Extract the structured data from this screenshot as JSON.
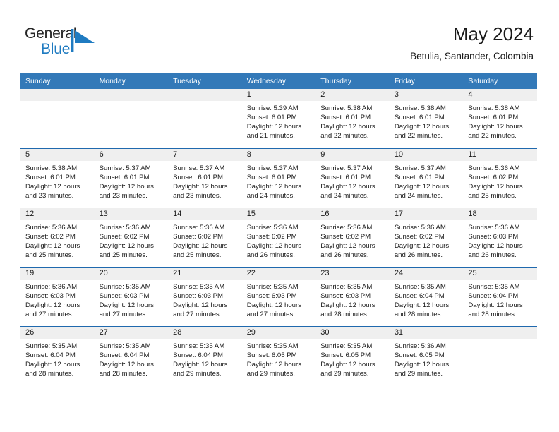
{
  "brand": {
    "name_part1": "General",
    "name_part2": "Blue",
    "mark_icon": "blue-flag-triangle-icon",
    "accent_color": "#1f7bc1"
  },
  "header": {
    "title": "May 2024",
    "subtitle": "Betulia, Santander, Colombia"
  },
  "colors": {
    "header_row_bg": "#3379b8",
    "row_separator": "#1f69ae",
    "daynum_bg": "#efefef",
    "text": "#1a1a1a"
  },
  "weekdays": [
    "Sunday",
    "Monday",
    "Tuesday",
    "Wednesday",
    "Thursday",
    "Friday",
    "Saturday"
  ],
  "weeks": [
    [
      {
        "day": "",
        "empty": true,
        "sunrise": "",
        "sunset": "",
        "daylight1": "",
        "daylight2": ""
      },
      {
        "day": "",
        "empty": true,
        "sunrise": "",
        "sunset": "",
        "daylight1": "",
        "daylight2": ""
      },
      {
        "day": "",
        "empty": true,
        "sunrise": "",
        "sunset": "",
        "daylight1": "",
        "daylight2": ""
      },
      {
        "day": "1",
        "empty": false,
        "sunrise": "Sunrise: 5:39 AM",
        "sunset": "Sunset: 6:01 PM",
        "daylight1": "Daylight: 12 hours",
        "daylight2": "and 21 minutes."
      },
      {
        "day": "2",
        "empty": false,
        "sunrise": "Sunrise: 5:38 AM",
        "sunset": "Sunset: 6:01 PM",
        "daylight1": "Daylight: 12 hours",
        "daylight2": "and 22 minutes."
      },
      {
        "day": "3",
        "empty": false,
        "sunrise": "Sunrise: 5:38 AM",
        "sunset": "Sunset: 6:01 PM",
        "daylight1": "Daylight: 12 hours",
        "daylight2": "and 22 minutes."
      },
      {
        "day": "4",
        "empty": false,
        "sunrise": "Sunrise: 5:38 AM",
        "sunset": "Sunset: 6:01 PM",
        "daylight1": "Daylight: 12 hours",
        "daylight2": "and 22 minutes."
      }
    ],
    [
      {
        "day": "5",
        "empty": false,
        "sunrise": "Sunrise: 5:38 AM",
        "sunset": "Sunset: 6:01 PM",
        "daylight1": "Daylight: 12 hours",
        "daylight2": "and 23 minutes."
      },
      {
        "day": "6",
        "empty": false,
        "sunrise": "Sunrise: 5:37 AM",
        "sunset": "Sunset: 6:01 PM",
        "daylight1": "Daylight: 12 hours",
        "daylight2": "and 23 minutes."
      },
      {
        "day": "7",
        "empty": false,
        "sunrise": "Sunrise: 5:37 AM",
        "sunset": "Sunset: 6:01 PM",
        "daylight1": "Daylight: 12 hours",
        "daylight2": "and 23 minutes."
      },
      {
        "day": "8",
        "empty": false,
        "sunrise": "Sunrise: 5:37 AM",
        "sunset": "Sunset: 6:01 PM",
        "daylight1": "Daylight: 12 hours",
        "daylight2": "and 24 minutes."
      },
      {
        "day": "9",
        "empty": false,
        "sunrise": "Sunrise: 5:37 AM",
        "sunset": "Sunset: 6:01 PM",
        "daylight1": "Daylight: 12 hours",
        "daylight2": "and 24 minutes."
      },
      {
        "day": "10",
        "empty": false,
        "sunrise": "Sunrise: 5:37 AM",
        "sunset": "Sunset: 6:01 PM",
        "daylight1": "Daylight: 12 hours",
        "daylight2": "and 24 minutes."
      },
      {
        "day": "11",
        "empty": false,
        "sunrise": "Sunrise: 5:36 AM",
        "sunset": "Sunset: 6:02 PM",
        "daylight1": "Daylight: 12 hours",
        "daylight2": "and 25 minutes."
      }
    ],
    [
      {
        "day": "12",
        "empty": false,
        "sunrise": "Sunrise: 5:36 AM",
        "sunset": "Sunset: 6:02 PM",
        "daylight1": "Daylight: 12 hours",
        "daylight2": "and 25 minutes."
      },
      {
        "day": "13",
        "empty": false,
        "sunrise": "Sunrise: 5:36 AM",
        "sunset": "Sunset: 6:02 PM",
        "daylight1": "Daylight: 12 hours",
        "daylight2": "and 25 minutes."
      },
      {
        "day": "14",
        "empty": false,
        "sunrise": "Sunrise: 5:36 AM",
        "sunset": "Sunset: 6:02 PM",
        "daylight1": "Daylight: 12 hours",
        "daylight2": "and 25 minutes."
      },
      {
        "day": "15",
        "empty": false,
        "sunrise": "Sunrise: 5:36 AM",
        "sunset": "Sunset: 6:02 PM",
        "daylight1": "Daylight: 12 hours",
        "daylight2": "and 26 minutes."
      },
      {
        "day": "16",
        "empty": false,
        "sunrise": "Sunrise: 5:36 AM",
        "sunset": "Sunset: 6:02 PM",
        "daylight1": "Daylight: 12 hours",
        "daylight2": "and 26 minutes."
      },
      {
        "day": "17",
        "empty": false,
        "sunrise": "Sunrise: 5:36 AM",
        "sunset": "Sunset: 6:02 PM",
        "daylight1": "Daylight: 12 hours",
        "daylight2": "and 26 minutes."
      },
      {
        "day": "18",
        "empty": false,
        "sunrise": "Sunrise: 5:36 AM",
        "sunset": "Sunset: 6:03 PM",
        "daylight1": "Daylight: 12 hours",
        "daylight2": "and 26 minutes."
      }
    ],
    [
      {
        "day": "19",
        "empty": false,
        "sunrise": "Sunrise: 5:36 AM",
        "sunset": "Sunset: 6:03 PM",
        "daylight1": "Daylight: 12 hours",
        "daylight2": "and 27 minutes."
      },
      {
        "day": "20",
        "empty": false,
        "sunrise": "Sunrise: 5:35 AM",
        "sunset": "Sunset: 6:03 PM",
        "daylight1": "Daylight: 12 hours",
        "daylight2": "and 27 minutes."
      },
      {
        "day": "21",
        "empty": false,
        "sunrise": "Sunrise: 5:35 AM",
        "sunset": "Sunset: 6:03 PM",
        "daylight1": "Daylight: 12 hours",
        "daylight2": "and 27 minutes."
      },
      {
        "day": "22",
        "empty": false,
        "sunrise": "Sunrise: 5:35 AM",
        "sunset": "Sunset: 6:03 PM",
        "daylight1": "Daylight: 12 hours",
        "daylight2": "and 27 minutes."
      },
      {
        "day": "23",
        "empty": false,
        "sunrise": "Sunrise: 5:35 AM",
        "sunset": "Sunset: 6:03 PM",
        "daylight1": "Daylight: 12 hours",
        "daylight2": "and 28 minutes."
      },
      {
        "day": "24",
        "empty": false,
        "sunrise": "Sunrise: 5:35 AM",
        "sunset": "Sunset: 6:04 PM",
        "daylight1": "Daylight: 12 hours",
        "daylight2": "and 28 minutes."
      },
      {
        "day": "25",
        "empty": false,
        "sunrise": "Sunrise: 5:35 AM",
        "sunset": "Sunset: 6:04 PM",
        "daylight1": "Daylight: 12 hours",
        "daylight2": "and 28 minutes."
      }
    ],
    [
      {
        "day": "26",
        "empty": false,
        "sunrise": "Sunrise: 5:35 AM",
        "sunset": "Sunset: 6:04 PM",
        "daylight1": "Daylight: 12 hours",
        "daylight2": "and 28 minutes."
      },
      {
        "day": "27",
        "empty": false,
        "sunrise": "Sunrise: 5:35 AM",
        "sunset": "Sunset: 6:04 PM",
        "daylight1": "Daylight: 12 hours",
        "daylight2": "and 28 minutes."
      },
      {
        "day": "28",
        "empty": false,
        "sunrise": "Sunrise: 5:35 AM",
        "sunset": "Sunset: 6:04 PM",
        "daylight1": "Daylight: 12 hours",
        "daylight2": "and 29 minutes."
      },
      {
        "day": "29",
        "empty": false,
        "sunrise": "Sunrise: 5:35 AM",
        "sunset": "Sunset: 6:05 PM",
        "daylight1": "Daylight: 12 hours",
        "daylight2": "and 29 minutes."
      },
      {
        "day": "30",
        "empty": false,
        "sunrise": "Sunrise: 5:35 AM",
        "sunset": "Sunset: 6:05 PM",
        "daylight1": "Daylight: 12 hours",
        "daylight2": "and 29 minutes."
      },
      {
        "day": "31",
        "empty": false,
        "sunrise": "Sunrise: 5:36 AM",
        "sunset": "Sunset: 6:05 PM",
        "daylight1": "Daylight: 12 hours",
        "daylight2": "and 29 minutes."
      },
      {
        "day": "",
        "empty": true,
        "sunrise": "",
        "sunset": "",
        "daylight1": "",
        "daylight2": ""
      }
    ]
  ]
}
